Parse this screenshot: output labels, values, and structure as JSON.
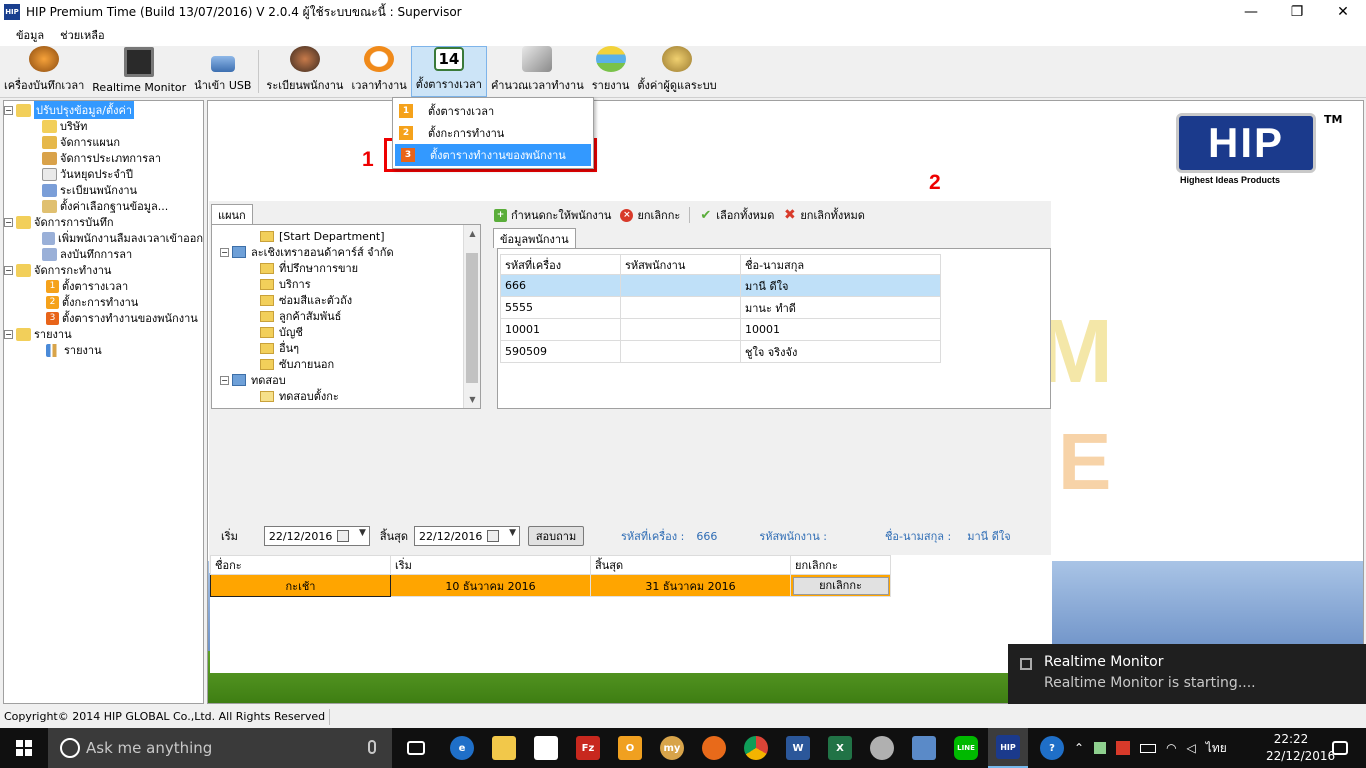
{
  "window": {
    "title": "HIP Premium Time (Build 13/07/2016) V 2.0.4   ผู้ใช้ระบบขณะนี้ : Supervisor",
    "app_icon": "HIP",
    "min_glyph": "—",
    "max_glyph": "❐",
    "close_glyph": "✕"
  },
  "menu": [
    "ข้อมูล",
    "ช่วยเหลือ"
  ],
  "toolbar": [
    {
      "label": "เครื่องบันทึกเวลา",
      "icon": "alarm-clock-icon"
    },
    {
      "label": "Realtime Monitor",
      "icon": "monitor-icon"
    },
    {
      "label": "นำเข้า USB",
      "icon": "usb-icon"
    },
    {
      "label": "ระเบียนพนักงาน",
      "icon": "employees-icon"
    },
    {
      "label": "เวลาทำงาน",
      "icon": "stopwatch-icon"
    },
    {
      "label": "ตั้งตารางเวลา",
      "icon": "calendar-icon",
      "icon_text": "14"
    },
    {
      "label": "คำนวณเวลาทำงาน",
      "icon": "calculate-icon"
    },
    {
      "label": "รายงาน",
      "icon": "report-icon"
    },
    {
      "label": "ตั้งค่าผู้ดูแลระบบ",
      "icon": "admin-settings-icon"
    }
  ],
  "dropdown": [
    {
      "num": "1",
      "label": "ตั้งตารางเวลา"
    },
    {
      "num": "2",
      "label": "ตั้งกะการทำงาน"
    },
    {
      "num": "3",
      "label": "ตั้งตารางทำงานของพนักงาน"
    }
  ],
  "annotations": {
    "one": "1",
    "two": "2"
  },
  "tree": {
    "g1": "ปรับปรุงข้อมูล/ตั้งค่า",
    "g1_items": [
      "บริษัท",
      "จัดการแผนก",
      "จัดการประเภทการลา",
      "วันหยุดประจำปี",
      "ระเบียนพนักงาน",
      "ตั้งค่าเลือกฐานข้อมูล..."
    ],
    "g2": "จัดการการบันทึก",
    "g2_items": [
      "เพิ่มพนักงานลืมลงเวลาเข้าออก",
      "ลงบันทึกการลา"
    ],
    "g3": "จัดการกะทำงาน",
    "g3_items": [
      "ตั้งตารางเวลา",
      "ตั้งกะการทำงาน",
      "ตั้งตารางทำงานของพนักงาน"
    ],
    "g3_nums": [
      "1",
      "2",
      "3"
    ],
    "g4": "รายงาน",
    "g4_items": [
      "รายงาน"
    ]
  },
  "dept": {
    "tab": "แผนก",
    "start": "[Start Department]",
    "company": "ละเชิงเทราฮอนด้าคาร์ส์ จำกัด",
    "items": [
      "ที่ปรึกษาการขาย",
      "บริการ",
      "ซ่อมสีและตัวถัง",
      "ลูกค้าสัมพันธ์",
      "บัญชี",
      "อื่นๆ",
      "ซับภายนอก"
    ],
    "test": "ทดสอบ",
    "test_item": "ทดสอบตั้งกะ"
  },
  "actions": {
    "assign": "กำหนดกะให้พนักงาน",
    "cancel": "ยกเลิกกะ",
    "select_all": "เลือกทั้งหมด",
    "cancel_all": "ยกเลิกทั้งหมด"
  },
  "employee": {
    "tab": "ข้อมูลพนักงาน",
    "headers": [
      "รหัสที่เครื่อง",
      "รหัสพนักงาน",
      "ชื่อ-นามสกุล"
    ],
    "rows": [
      [
        "666",
        "",
        "มานี ดีใจ"
      ],
      [
        "5555",
        "",
        "มานะ ทำดี"
      ],
      [
        "10001",
        "",
        "10001"
      ],
      [
        "590509",
        "",
        "ชูใจ จริงจัง"
      ]
    ]
  },
  "filter": {
    "start_label": "เริ่ม",
    "start_value": "22/12/2016",
    "end_label": "สิ้นสุด",
    "end_value": "22/12/2016",
    "search_button": "สอบถาม",
    "machine_label": "รหัสที่เครื่อง :",
    "machine_value": "666",
    "emp_label": "รหัสพนักงาน :",
    "name_label": "ชื่อ-นามสกุล :",
    "name_value": "มานี ดีใจ"
  },
  "shift": {
    "headers": [
      "ชื่อกะ",
      "เริ่ม",
      "สิ้นสุด",
      "ยกเลิกกะ"
    ],
    "row": [
      "กะเช้า",
      "10 ธันวาคม 2016",
      "31 ธันวาคม 2016",
      "ยกเลิกกะ"
    ]
  },
  "logo": {
    "text": "HIP",
    "tm": "TM",
    "sub": "Highest Ideas Products"
  },
  "background_letters": {
    "m": "M",
    "e": "E"
  },
  "statusbar": "Copyright© 2014 HIP GLOBAL Co.,Ltd. All Rights Reserved",
  "toast": {
    "title": "Realtime Monitor",
    "message": "Realtime Monitor is starting...."
  },
  "taskbar": {
    "search_placeholder": "Ask me anything",
    "time": "22:22",
    "date": "22/12/2016",
    "lang": "ไทย"
  },
  "colors": {
    "accent": "#3399ff",
    "shift_row": "#ffa500",
    "annotation": "#e00000"
  }
}
